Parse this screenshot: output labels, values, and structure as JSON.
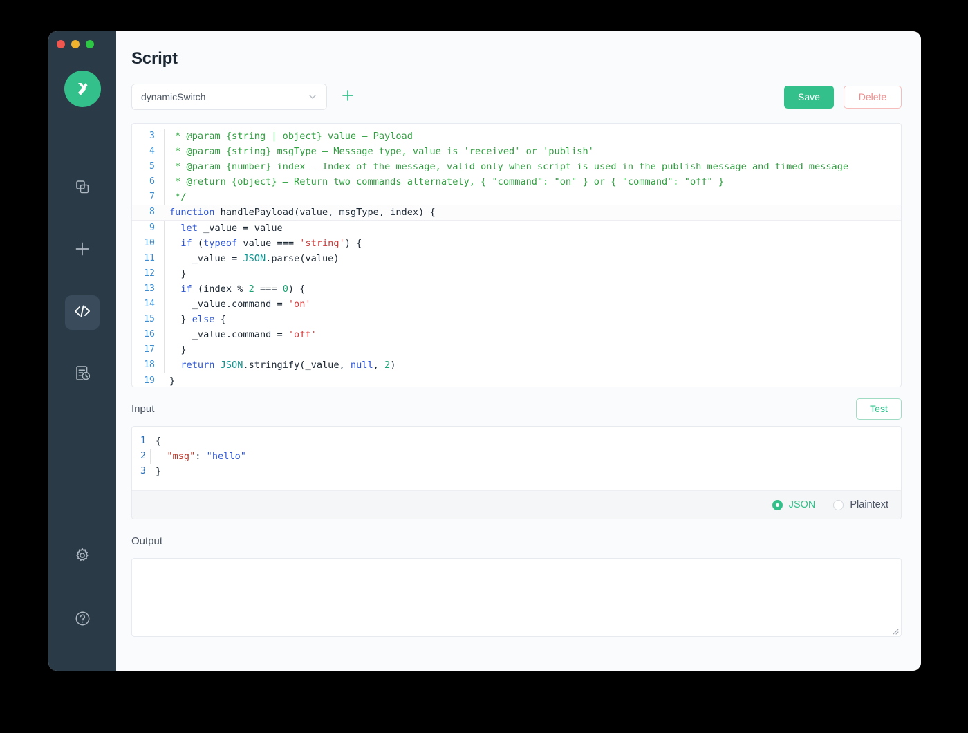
{
  "window": {
    "traffic_lights": [
      "close",
      "minimize",
      "maximize"
    ]
  },
  "sidebar": {
    "logo_name": "emqx-logo",
    "items": [
      {
        "name": "copy-squares-icon",
        "icon": "copy-squares-icon",
        "active": false
      },
      {
        "name": "plus-icon",
        "icon": "plus-icon",
        "active": false
      },
      {
        "name": "code-icon",
        "icon": "code-icon",
        "active": true
      },
      {
        "name": "log-history-icon",
        "icon": "log-history-icon",
        "active": false
      }
    ],
    "bottom_items": [
      {
        "name": "gear-icon",
        "icon": "gear-icon"
      },
      {
        "name": "help-icon",
        "icon": "help-icon"
      }
    ]
  },
  "header": {
    "title": "Script"
  },
  "toolbar": {
    "script_selected": "dynamicSwitch",
    "dropdown_icon": "chevron-down-icon",
    "add_icon": "plus-icon",
    "save_label": "Save",
    "delete_label": "Delete"
  },
  "editor": {
    "first_visible_line": 3,
    "active_line": 8,
    "lines": [
      {
        "n": 3,
        "guide": true,
        "tokens": [
          {
            "t": " * @param {string | object} value — Payload",
            "c": "cm"
          }
        ]
      },
      {
        "n": 4,
        "guide": true,
        "tokens": [
          {
            "t": " * @param {string} msgType — Message type, value is 'received' or 'publish'",
            "c": "cm"
          }
        ]
      },
      {
        "n": 5,
        "guide": true,
        "tokens": [
          {
            "t": " * @param {number} index — Index of the message, valid only when script is used in the publish message and timed message",
            "c": "cm"
          }
        ]
      },
      {
        "n": 6,
        "guide": true,
        "tokens": [
          {
            "t": " * @return {object} — Return two commands alternately, { \"command\": \"on\" } or { \"command\": \"off\" }",
            "c": "cm"
          }
        ]
      },
      {
        "n": 7,
        "guide": true,
        "tokens": [
          {
            "t": " */",
            "c": "cm"
          }
        ]
      },
      {
        "n": 8,
        "guide": false,
        "tokens": [
          {
            "t": "function",
            "c": "kw"
          },
          {
            "t": " handlePayload",
            "c": "fn"
          },
          {
            "t": "(value, msgType, index) {",
            "c": "pl"
          }
        ]
      },
      {
        "n": 9,
        "guide": true,
        "tokens": [
          {
            "t": "  ",
            "c": "pl"
          },
          {
            "t": "let",
            "c": "kw"
          },
          {
            "t": " _value = value",
            "c": "pl"
          }
        ]
      },
      {
        "n": 10,
        "guide": true,
        "tokens": [
          {
            "t": "  ",
            "c": "pl"
          },
          {
            "t": "if",
            "c": "kw"
          },
          {
            "t": " (",
            "c": "pl"
          },
          {
            "t": "typeof",
            "c": "kw"
          },
          {
            "t": " value === ",
            "c": "pl"
          },
          {
            "t": "'string'",
            "c": "str"
          },
          {
            "t": ") {",
            "c": "pl"
          }
        ]
      },
      {
        "n": 11,
        "guide": true,
        "tokens": [
          {
            "t": "    _value = ",
            "c": "pl"
          },
          {
            "t": "JSON",
            "c": "obj"
          },
          {
            "t": ".parse(value)",
            "c": "pl"
          }
        ]
      },
      {
        "n": 12,
        "guide": true,
        "tokens": [
          {
            "t": "  }",
            "c": "pl"
          }
        ]
      },
      {
        "n": 13,
        "guide": true,
        "tokens": [
          {
            "t": "  ",
            "c": "pl"
          },
          {
            "t": "if",
            "c": "kw"
          },
          {
            "t": " (index % ",
            "c": "pl"
          },
          {
            "t": "2",
            "c": "num"
          },
          {
            "t": " === ",
            "c": "pl"
          },
          {
            "t": "0",
            "c": "num"
          },
          {
            "t": ") {",
            "c": "pl"
          }
        ]
      },
      {
        "n": 14,
        "guide": true,
        "tokens": [
          {
            "t": "    _value.command = ",
            "c": "pl"
          },
          {
            "t": "'on'",
            "c": "str"
          }
        ]
      },
      {
        "n": 15,
        "guide": true,
        "tokens": [
          {
            "t": "  } ",
            "c": "pl"
          },
          {
            "t": "else",
            "c": "kw"
          },
          {
            "t": " {",
            "c": "pl"
          }
        ]
      },
      {
        "n": 16,
        "guide": true,
        "tokens": [
          {
            "t": "    _value.command = ",
            "c": "pl"
          },
          {
            "t": "'off'",
            "c": "str"
          }
        ]
      },
      {
        "n": 17,
        "guide": true,
        "tokens": [
          {
            "t": "  }",
            "c": "pl"
          }
        ]
      },
      {
        "n": 18,
        "guide": true,
        "tokens": [
          {
            "t": "  ",
            "c": "pl"
          },
          {
            "t": "return",
            "c": "kw"
          },
          {
            "t": " ",
            "c": "pl"
          },
          {
            "t": "JSON",
            "c": "obj"
          },
          {
            "t": ".stringify(_value, ",
            "c": "pl"
          },
          {
            "t": "null",
            "c": "kw"
          },
          {
            "t": ", ",
            "c": "pl"
          },
          {
            "t": "2",
            "c": "num"
          },
          {
            "t": ")",
            "c": "pl"
          }
        ]
      },
      {
        "n": 19,
        "guide": false,
        "tokens": [
          {
            "t": "}",
            "c": "pl"
          }
        ]
      }
    ]
  },
  "input_section": {
    "label": "Input",
    "test_label": "Test",
    "lines": [
      {
        "n": 1,
        "guide": false,
        "tokens": [
          {
            "t": "{",
            "c": "jpunc"
          }
        ]
      },
      {
        "n": 2,
        "guide": true,
        "tokens": [
          {
            "t": "  ",
            "c": "jpunc"
          },
          {
            "t": "\"msg\"",
            "c": "jkey"
          },
          {
            "t": ": ",
            "c": "jpunc"
          },
          {
            "t": "\"hello\"",
            "c": "jstr"
          }
        ]
      },
      {
        "n": 3,
        "guide": false,
        "tokens": [
          {
            "t": "}",
            "c": "jpunc"
          }
        ]
      }
    ],
    "format_options": [
      {
        "label": "JSON",
        "selected": true
      },
      {
        "label": "Plaintext",
        "selected": false
      }
    ]
  },
  "output_section": {
    "label": "Output",
    "value": "",
    "resize_handle": "resize-handle-icon"
  },
  "colors": {
    "accent_green": "#34c08a",
    "sidebar_bg": "#2b3a47",
    "delete_red": "#f28b8b",
    "comment_green": "#2e9e3e",
    "keyword_blue": "#2f57d4",
    "string_red": "#d03a3a"
  }
}
